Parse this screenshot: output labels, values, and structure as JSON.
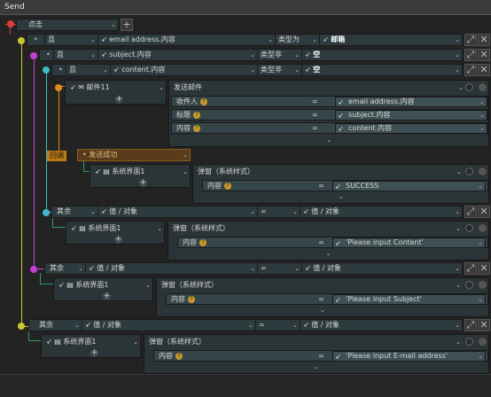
{
  "window": {
    "title": "Send"
  },
  "colors": {
    "red": "#e03a3a",
    "yellow": "#c9c632",
    "magenta": "#c33fd0",
    "cyan": "#3fb8c9",
    "orange": "#e08a1e"
  },
  "event": {
    "trigger": "点击"
  },
  "cond1": {
    "op": "且",
    "field": "email address.内容",
    "test": "类型为",
    "value": "邮箱"
  },
  "cond2": {
    "op": "且",
    "field": "subject.内容",
    "test": "类型非",
    "value": "空"
  },
  "cond3": {
    "op": "且",
    "field": "content.内容",
    "test": "类型非",
    "value": "空"
  },
  "mail": {
    "node_name": "邮件11",
    "action": "发送邮件",
    "rows": [
      {
        "label": "收件人",
        "eq": "=",
        "value": "email address.内容"
      },
      {
        "label": "标题",
        "eq": "=",
        "value": "subject.内容"
      },
      {
        "label": "内容",
        "eq": "=",
        "value": "content.内容"
      }
    ]
  },
  "callback": {
    "tag": "回调",
    "event": "发送成功"
  },
  "popup_success": {
    "node_name": "系统界面1",
    "action": "弹窗（系统样式）",
    "label": "内容",
    "eq": "=",
    "value": "SUCCESS"
  },
  "else3": {
    "op": "其余",
    "field": "值 / 对象",
    "eq": "=",
    "value": "值 / 对象",
    "node_name": "系统界面1",
    "action": "弹窗（系统样式）",
    "label": "内容",
    "eq2": "=",
    "msg": "'Please input Content'"
  },
  "else2": {
    "op": "其余",
    "field": "值 / 对象",
    "eq": "=",
    "value": "值 / 对象",
    "node_name": "系统界面1",
    "action": "弹窗（系统样式）",
    "label": "内容",
    "eq2": "=",
    "msg": "'Please input Subject'"
  },
  "else1": {
    "op": "其余",
    "field": "值 / 对象",
    "eq": "=",
    "value": "值 / 对象",
    "node_name": "系统界面1",
    "action": "弹窗（系统样式）",
    "label": "内容",
    "eq2": "=",
    "msg": "'Please input E-mail address'"
  },
  "icons": [
    "cursor-icon",
    "mail-icon",
    "window-icon",
    "expand-icon",
    "close-icon",
    "plus-icon",
    "help-icon",
    "chevron-down-icon"
  ]
}
